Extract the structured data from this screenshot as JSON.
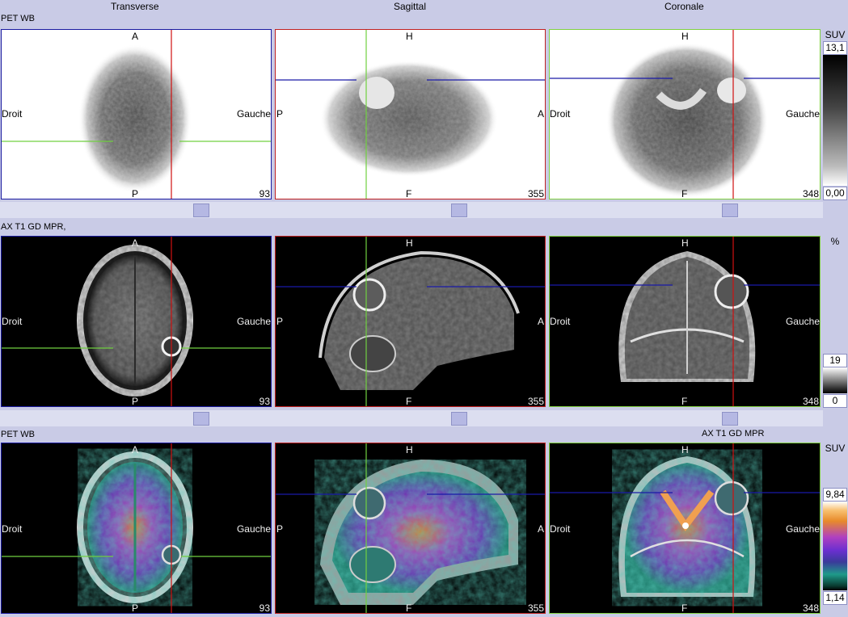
{
  "headers": {
    "transverse": "Transverse",
    "sagittal": "Sagittal",
    "coronal": "Coronale"
  },
  "rows": {
    "pet": {
      "label": "PET WB"
    },
    "mr": {
      "label": "AX T1 GD MPR,"
    },
    "fusion": {
      "label_left": "PET WB",
      "label_right": "AX T1 GD MPR"
    }
  },
  "orientation": {
    "transverse": {
      "top": "A",
      "bottom": "P",
      "left": "Droit",
      "right": "Gauche"
    },
    "sagittal": {
      "top": "H",
      "bottom": "F",
      "left": "P",
      "right": "A"
    },
    "coronal": {
      "top": "H",
      "bottom": "F",
      "left": "Droit",
      "right": "Gauche"
    }
  },
  "slices": {
    "transverse": "93",
    "sagittal": "355",
    "coronal": "348"
  },
  "colorbars": {
    "pet": {
      "unit": "SUV",
      "max": "13,1",
      "min": "0,00"
    },
    "mr": {
      "unit": "%",
      "max": "19",
      "min": "0"
    },
    "fusion": {
      "unit": "SUV",
      "max": "9,84",
      "min": "1,14"
    }
  },
  "colors": {
    "transverse_frame": "#1a1aa0",
    "sagittal_frame": "#c02020",
    "coronal_frame": "#80d040",
    "crosshair_red": "#d01010",
    "crosshair_blue": "#1a1aa8",
    "crosshair_green": "#70d040"
  }
}
